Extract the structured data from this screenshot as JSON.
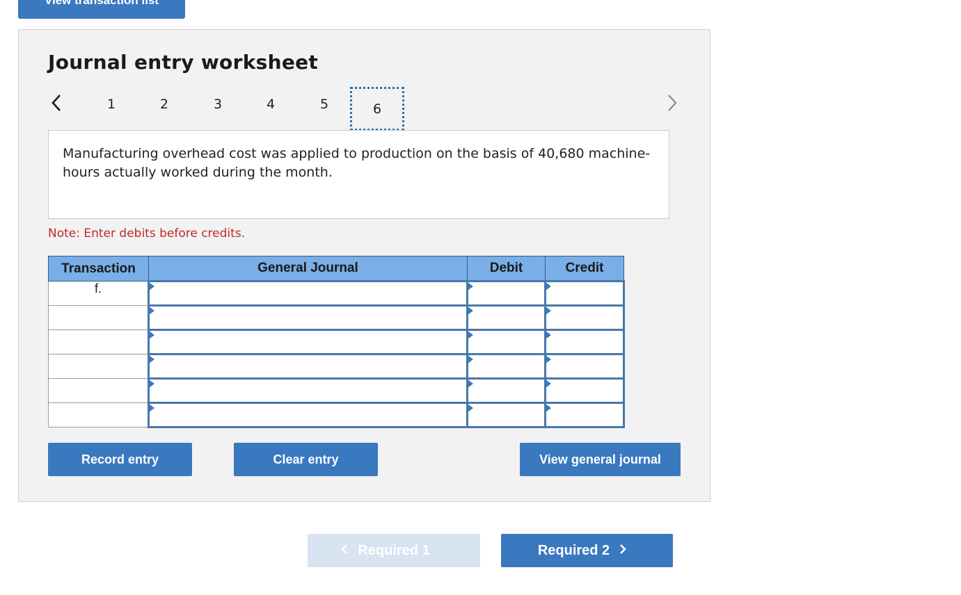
{
  "top_button": {
    "label": "View transaction list"
  },
  "worksheet": {
    "title": "Journal entry worksheet",
    "steps": [
      "1",
      "2",
      "3",
      "4",
      "5",
      "6"
    ],
    "active_step": "6",
    "description": "Manufacturing overhead cost was applied to production on the basis of 40,680 machine-hours actually worked during the month.",
    "note": "Note: Enter debits before credits."
  },
  "table": {
    "headers": {
      "transaction": "Transaction",
      "general_journal": "General Journal",
      "debit": "Debit",
      "credit": "Credit"
    },
    "rows": [
      {
        "transaction": "f.",
        "account": "",
        "debit": "",
        "credit": ""
      },
      {
        "transaction": "",
        "account": "",
        "debit": "",
        "credit": ""
      },
      {
        "transaction": "",
        "account": "",
        "debit": "",
        "credit": ""
      },
      {
        "transaction": "",
        "account": "",
        "debit": "",
        "credit": ""
      },
      {
        "transaction": "",
        "account": "",
        "debit": "",
        "credit": ""
      },
      {
        "transaction": "",
        "account": "",
        "debit": "",
        "credit": ""
      }
    ]
  },
  "buttons": {
    "record": "Record entry",
    "clear": "Clear entry",
    "view_journal": "View general journal"
  },
  "required_nav": {
    "prev_label": "Required 1",
    "next_label": "Required 2"
  },
  "colors": {
    "primary": "#3a78bf",
    "header_blue": "#7aaee6",
    "note_red": "#c0282a",
    "disabled": "#d7e3f1"
  },
  "icons": {
    "prev": "chevron-left-icon",
    "next": "chevron-right-icon"
  }
}
